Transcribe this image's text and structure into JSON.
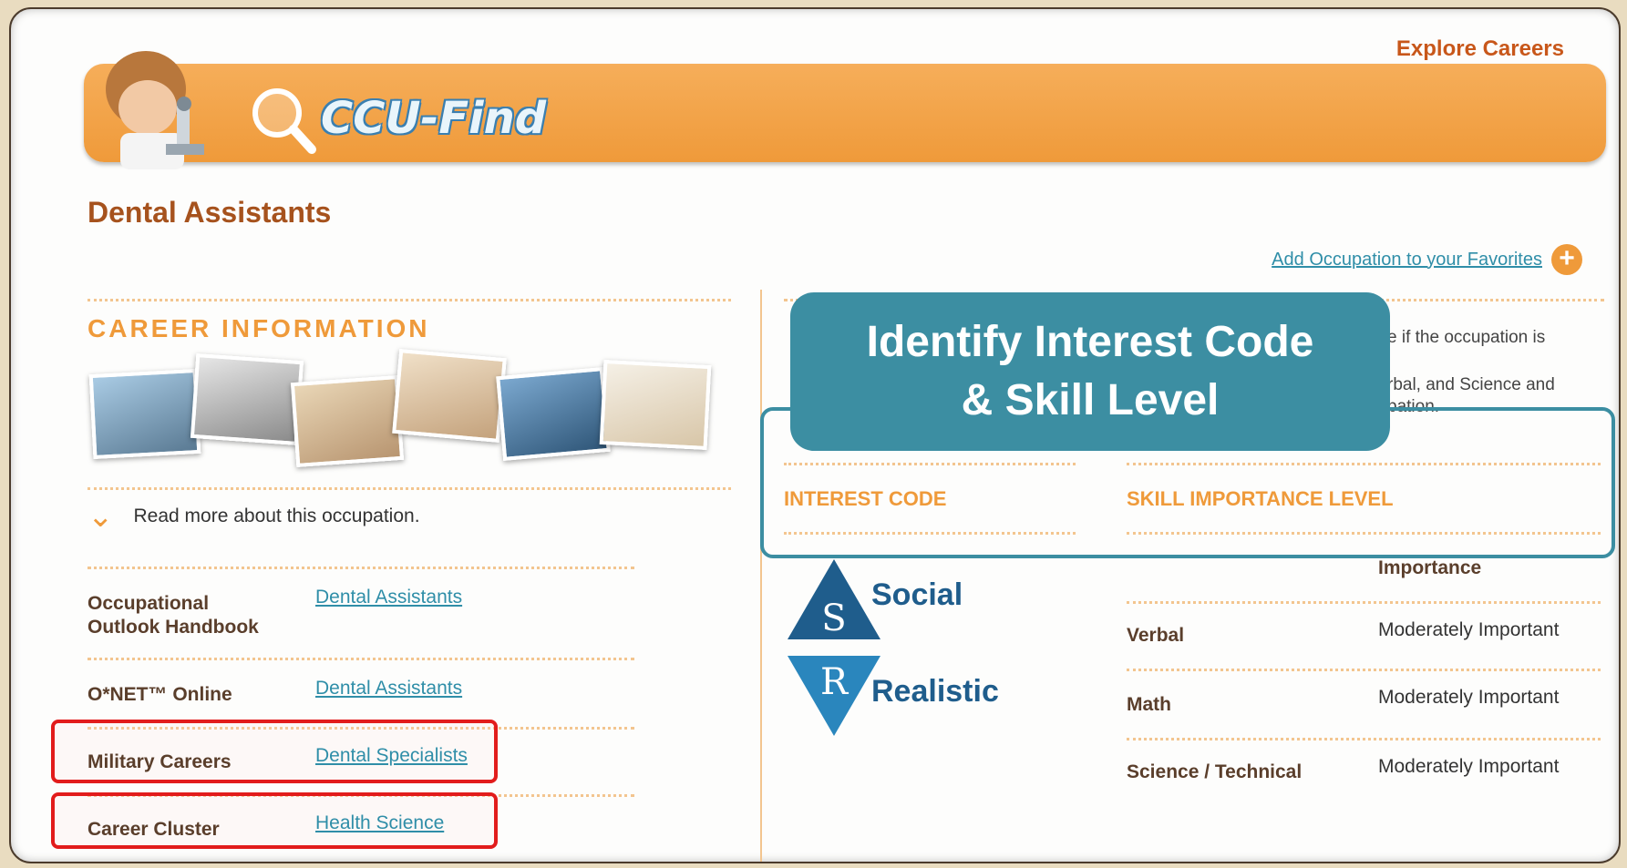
{
  "header": {
    "explore_link": "Explore Careers",
    "logo_text": "CCU-Find"
  },
  "page_title": "Dental Assistants",
  "favorites_link": "Add Occupation to your Favorites",
  "career_info": {
    "heading": "CAREER INFORMATION",
    "read_more": "Read more about this occupation."
  },
  "resources": [
    {
      "label": "Occupational\nOutlook Handbook",
      "link": "Dental Assistants"
    },
    {
      "label": "O*NET™ Online",
      "link": "Dental Assistants"
    },
    {
      "label": "Military Careers",
      "link": "Dental Specialists"
    },
    {
      "label": "Career Cluster",
      "link": "Health Science"
    }
  ],
  "callout": {
    "line1": "Identify Interest Code",
    "line2": "& Skill Level"
  },
  "partial_text": {
    "line1": "e if the occupation is",
    "line2": "rbal, and Science and",
    "line3": "pation."
  },
  "interest_section": {
    "heading": "INTEREST CODE",
    "codes": [
      {
        "letter": "S",
        "name": "Social",
        "color": "#1f5d8c"
      },
      {
        "letter": "R",
        "name": "Realistic",
        "color": "#2a86bd"
      }
    ]
  },
  "skill_section": {
    "heading": "SKILL IMPORTANCE LEVEL",
    "column_header": "Importance",
    "rows": [
      {
        "skill": "Verbal",
        "level": "Moderately Important"
      },
      {
        "skill": "Math",
        "level": "Moderately Important"
      },
      {
        "skill": "Science / Technical",
        "level": "Moderately Important"
      }
    ]
  },
  "colors": {
    "accent_orange": "#ef9a3a",
    "title_brown": "#a6521d",
    "link_teal": "#2f8ea8",
    "callout_teal": "#3c8ea2",
    "highlight_red": "#e21c1c"
  }
}
